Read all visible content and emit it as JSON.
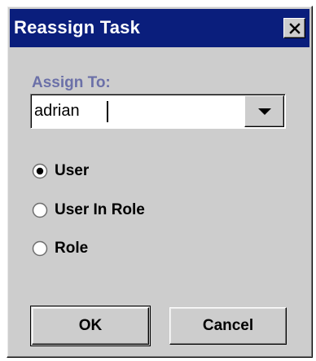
{
  "dialog": {
    "title": "Reassign Task",
    "close_icon": "close-icon",
    "assign_to": {
      "label": "Assign To:",
      "value": "adrian",
      "dropdown_icon": "chevron-down-icon"
    },
    "options": [
      {
        "label": "User",
        "selected": true
      },
      {
        "label": "User In Role",
        "selected": false
      },
      {
        "label": "Role",
        "selected": false
      }
    ],
    "buttons": {
      "ok": "OK",
      "cancel": "Cancel"
    },
    "colors": {
      "titlebar": "#0a1e7c",
      "label": "#6b70a8",
      "face": "#cdcdcd"
    }
  }
}
